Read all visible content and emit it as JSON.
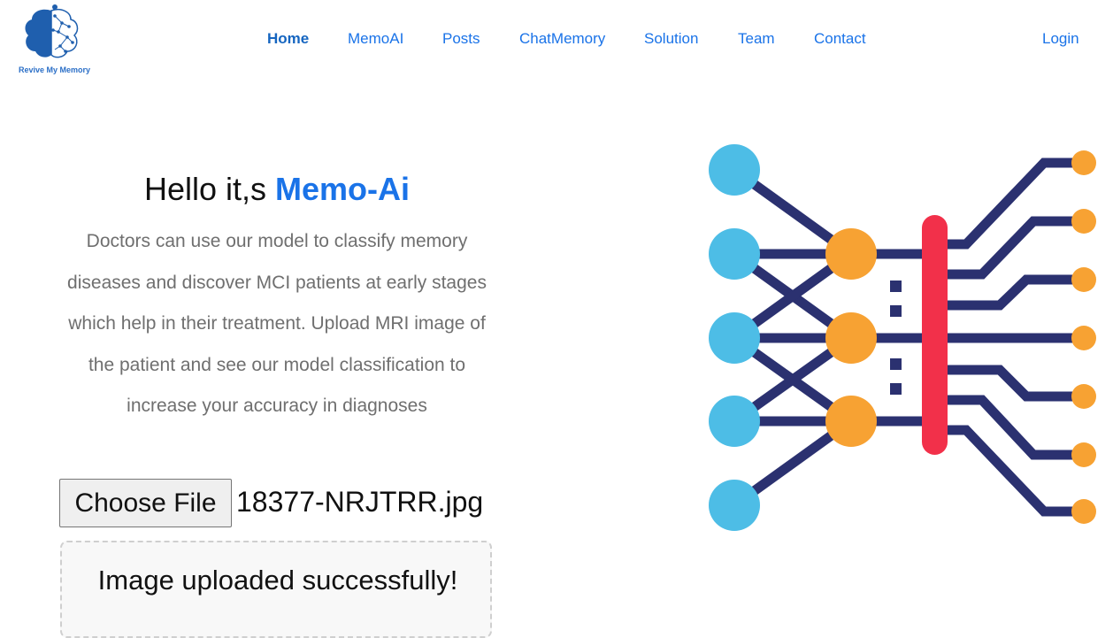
{
  "logo": {
    "icon": "brain-icon",
    "text": "Revive My Memory"
  },
  "nav": {
    "items": [
      {
        "label": "Home",
        "active": true
      },
      {
        "label": "MemoAI"
      },
      {
        "label": "Posts"
      },
      {
        "label": "ChatMemory"
      },
      {
        "label": "Solution"
      },
      {
        "label": "Team"
      },
      {
        "label": "Contact"
      }
    ],
    "login": "Login"
  },
  "hero": {
    "greeting": "Hello it,s",
    "brand": "Memo-Ai",
    "description": "Doctors can use our model to classify memory diseases and discover MCI patients at early stages which help in their treatment. Upload MRI image of the patient and see our model classification to increase your accuracy in diagnoses"
  },
  "upload": {
    "button_label": "Choose File",
    "file_name": "18377-NRJTRR.jpg",
    "status": "Image uploaded successfully!"
  },
  "illustration": {
    "icon": "neural-network-icon",
    "colors": {
      "input": "#4dbde6",
      "hidden": "#f7a233",
      "bar": "#f2304a",
      "lines": "#2b3170"
    }
  },
  "colors": {
    "accent": "#1a73e8",
    "text_muted": "#6f6f6f"
  }
}
